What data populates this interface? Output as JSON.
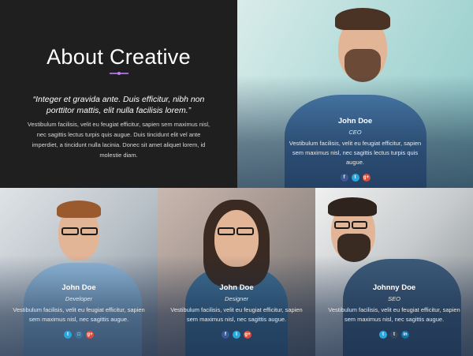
{
  "intro": {
    "title": "About Creative",
    "quote": "“Integer et gravida ante. Duis efficitur, nibh non porttitor mattis, elit nulla facilisis lorem.”",
    "body": "Vestibulum facilisis, velit eu feugiat efficitur, sapien sem maximus nisl, nec sagittis lectus turpis quis augue. Duis tincidunt elit vel ante imperdiet, a tincidunt nulla lacinia. Donec sit amet aliquet lorem, id molestie diam."
  },
  "team": [
    {
      "name": "John Doe",
      "role": "CEO",
      "desc": "Vestibulum facilisis, velit eu feugiat efficitur, sapien sem maximus nisl, nec sagittis lectus turpis quis augue.",
      "socials": [
        "f",
        "t",
        "g+"
      ]
    },
    {
      "name": "John Doe",
      "role": "Developer",
      "desc": "Vestibulum facilisis, velit eu feugiat efficitur, sapien sem maximus nisl, nec sagittis augue.",
      "socials": [
        "t",
        "□",
        "g+"
      ]
    },
    {
      "name": "John Doe",
      "role": "Designer",
      "desc": "Vestibulum facilisis, velit eu feugiat efficitur, sapien sem maximus nisl, nec sagittis augue.",
      "socials": [
        "f",
        "t",
        "g+"
      ]
    },
    {
      "name": "Johnny Doe",
      "role": "SEO",
      "desc": "Vestibulum facilisis, velit eu feugiat efficitur, sapien sem maximus nisl, nec sagittis augue.",
      "socials": [
        "t",
        "t",
        "in"
      ]
    }
  ]
}
